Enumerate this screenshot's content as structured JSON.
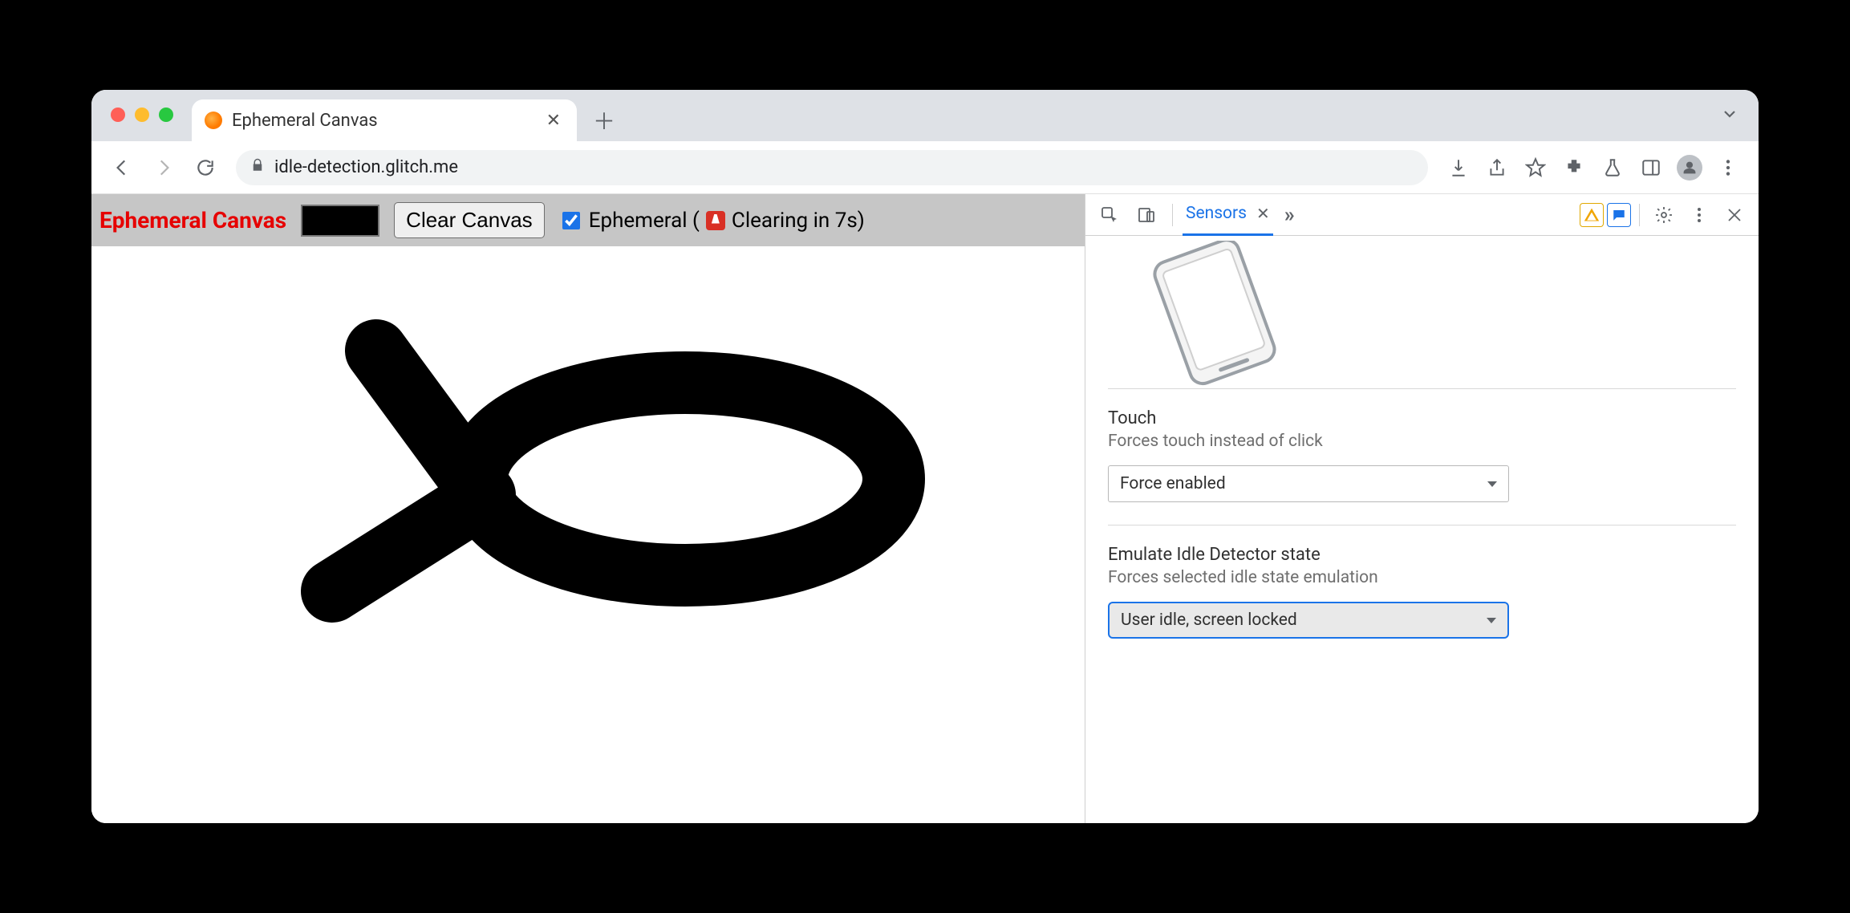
{
  "browser": {
    "tab_title": "Ephemeral Canvas",
    "url": "idle-detection.glitch.me"
  },
  "page": {
    "title": "Ephemeral Canvas",
    "clear_button": "Clear Canvas",
    "ephemeral_label_prefix": "Ephemeral (",
    "ephemeral_label_suffix": " Clearing in 7s)",
    "ephemeral_checked": true,
    "stroke_color": "#000000"
  },
  "devtools": {
    "active_panel": "Sensors",
    "touch": {
      "title": "Touch",
      "desc": "Forces touch instead of click",
      "value": "Force enabled"
    },
    "idle": {
      "title": "Emulate Idle Detector state",
      "desc": "Forces selected idle state emulation",
      "value": "User idle, screen locked"
    }
  }
}
